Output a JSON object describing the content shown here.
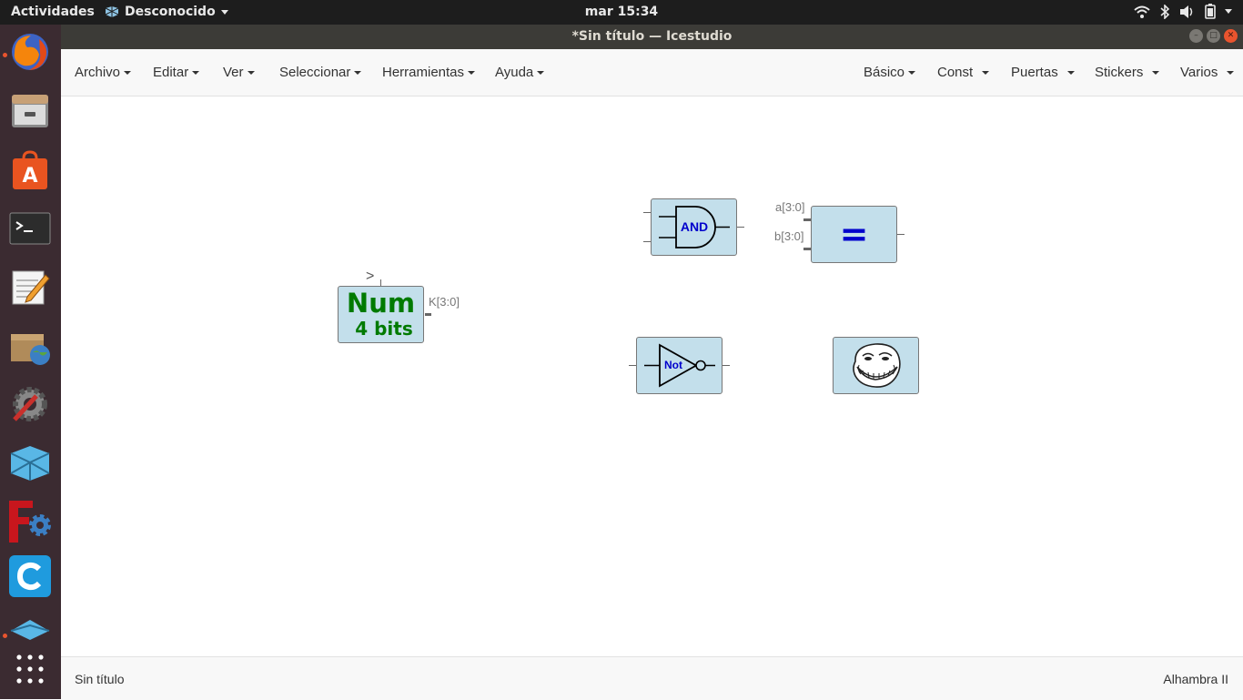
{
  "topbar": {
    "activities": "Actividades",
    "app_name": "Desconocido",
    "clock": "mar 15:34"
  },
  "window": {
    "title": "*Sin título — Icestudio"
  },
  "menubar": {
    "left": [
      "Archivo",
      "Editar",
      "Ver",
      "Seleccionar",
      "Herramientas",
      "Ayuda"
    ],
    "right": [
      "Básico",
      "Const",
      "Puertas",
      "Stickers",
      "Varios"
    ]
  },
  "canvas": {
    "num_block": {
      "title": "Num",
      "subtitle": "4 bits",
      "clock_mark": ">",
      "output_label": "K[3:0]"
    },
    "and_block": {
      "label": "AND"
    },
    "cmp_block": {
      "symbol": "=",
      "input_a": "a[3:0]",
      "input_b": "b[3:0]"
    },
    "not_block": {
      "label": "Not"
    },
    "sticker_block": {
      "name": "troll-face"
    }
  },
  "footer": {
    "file_name": "Sin título",
    "board": "Alhambra II"
  },
  "colors": {
    "block_fill": "#c3dfeb",
    "num_text": "#007a00",
    "gate_text": "#0000cc",
    "dock_bg": "#3b2b31",
    "topbar_bg": "#1d1d1d"
  },
  "dock": [
    "firefox-icon",
    "files-icon",
    "software-center-icon",
    "terminal-icon",
    "text-editor-icon",
    "archive-manager-icon",
    "system-tools-icon",
    "icestudio-icon",
    "freecad-icon",
    "cura-icon",
    "app-icon",
    "show-applications-icon"
  ]
}
